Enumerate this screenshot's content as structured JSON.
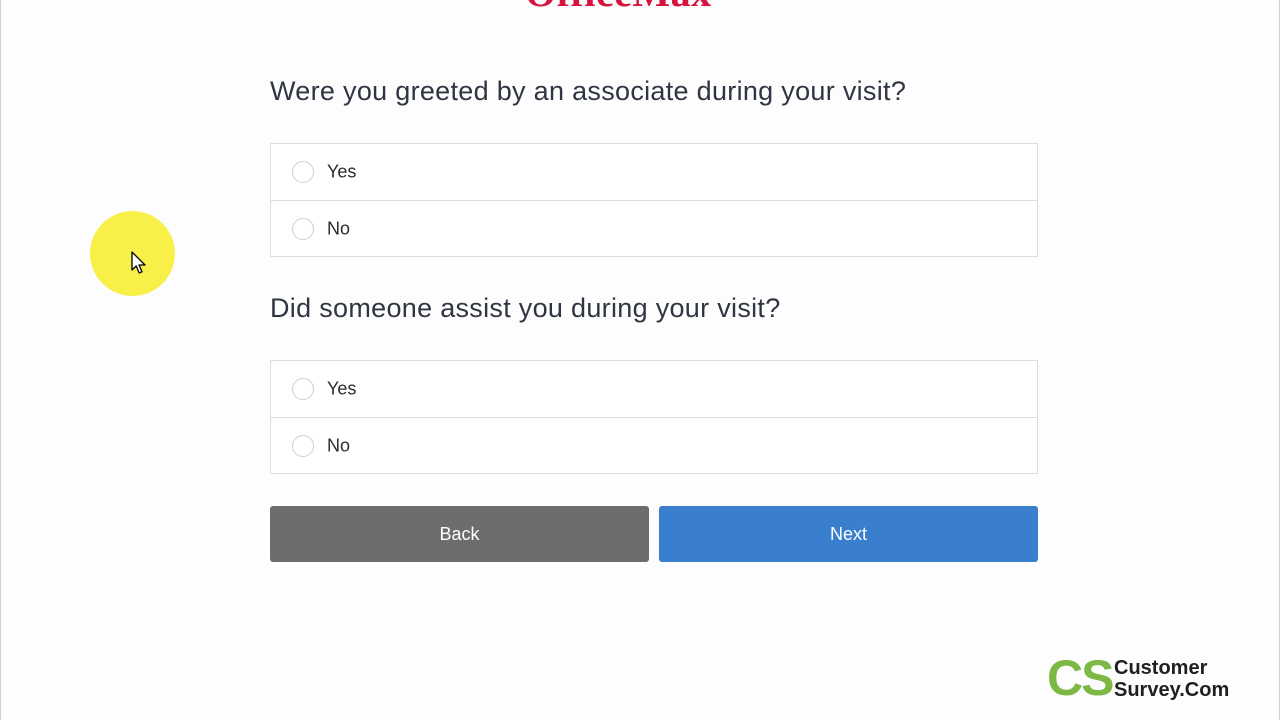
{
  "brand": {
    "logo_text": "OfficeMax",
    "logo_color": "#d6133e"
  },
  "questions": [
    {
      "text": "Were you greeted by an associate during your visit?",
      "options": [
        {
          "label": "Yes",
          "selected": false
        },
        {
          "label": "No",
          "selected": false
        }
      ]
    },
    {
      "text": "Did someone assist you during your visit?",
      "options": [
        {
          "label": "Yes",
          "selected": false
        },
        {
          "label": "No",
          "selected": false
        }
      ]
    }
  ],
  "navigation": {
    "back_label": "Back",
    "next_label": "Next",
    "back_color": "#6d6d6d",
    "next_color": "#3a7fcd"
  },
  "watermark": {
    "initials": "CS",
    "line1": "Customer",
    "line2": "Survey.Com",
    "initials_color": "#7cb843"
  },
  "cursor": {
    "icon": "mouse-pointer-icon",
    "highlight_color": "#f7ef3a"
  }
}
